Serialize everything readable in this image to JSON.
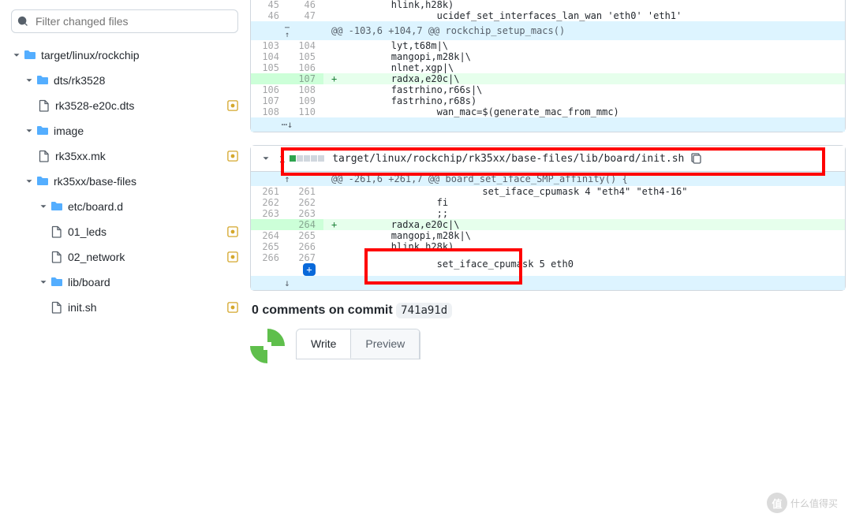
{
  "filter_placeholder": "Filter changed files",
  "tree": {
    "root": "target/linux/rockchip",
    "d1": "dts/rk3528",
    "f1": "rk3528-e20c.dts",
    "d2": "image",
    "f2": "rk35xx.mk",
    "d3": "rk35xx/base-files",
    "d4": "etc/board.d",
    "f3": "01_leds",
    "f4": "02_network",
    "d5": "lib/board",
    "f5": "init.sh"
  },
  "diff1": {
    "rows": [
      {
        "o": "45",
        "n": "46",
        "t": "        hlink,h28k)"
      },
      {
        "o": "46",
        "n": "47",
        "t": "                ucidef_set_interfaces_lan_wan 'eth0' 'eth1'"
      }
    ],
    "hunk": "@@ -103,6 +104,7 @@ rockchip_setup_macs()",
    "rows2": [
      {
        "o": "103",
        "n": "104",
        "t": "        lyt,t68m|\\"
      },
      {
        "o": "104",
        "n": "105",
        "t": "        mangopi,m28k|\\"
      },
      {
        "o": "105",
        "n": "106",
        "t": "        nlnet,xgp|\\"
      },
      {
        "o": "",
        "n": "107",
        "t": "        radxa,e20c|\\",
        "add": true
      },
      {
        "o": "106",
        "n": "108",
        "t": "        fastrhino,r66s|\\"
      },
      {
        "o": "107",
        "n": "109",
        "t": "        fastrhino,r68s)"
      },
      {
        "o": "108",
        "n": "110",
        "t": "                wan_mac=$(generate_mac_from_mmc)"
      }
    ]
  },
  "file2": {
    "count": "1",
    "path": "target/linux/rockchip/rk35xx/base-files/lib/board/init.sh"
  },
  "diff2": {
    "hunk": "@@ -261,6 +261,7 @@ board_set_iface_SMP_affinity() {",
    "rows": [
      {
        "o": "261",
        "n": "261",
        "t": "                        set_iface_cpumask 4 \"eth4\" \"eth4-16\""
      },
      {
        "o": "262",
        "n": "262",
        "t": "                fi"
      },
      {
        "o": "263",
        "n": "263",
        "t": "                ;;"
      },
      {
        "o": "",
        "n": "264",
        "t": "        radxa,e20c|\\",
        "add": true
      },
      {
        "o": "264",
        "n": "265",
        "t": "        mangopi,m28k|\\"
      },
      {
        "o": "265",
        "n": "266",
        "t": "        hlink,h28k)"
      },
      {
        "o": "266",
        "n": "267",
        "t": "                set_iface_cpumask 5 eth0",
        "blue": true
      }
    ]
  },
  "comments": {
    "header": "0 comments on commit",
    "sha": "741a91d",
    "tabs": {
      "write": "Write",
      "preview": "Preview"
    }
  },
  "watermark": "什么值得买"
}
